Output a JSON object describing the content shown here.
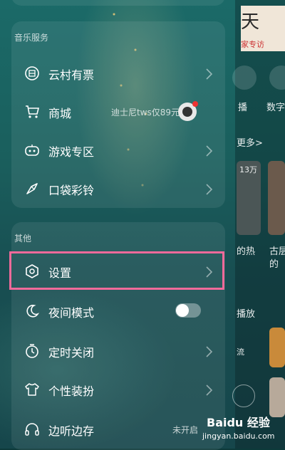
{
  "drawer": {
    "section_music": {
      "title": "音乐服务",
      "items": [
        {
          "label": "云村有票",
          "icon": "ticket-icon"
        },
        {
          "label": "商城",
          "icon": "cart-icon",
          "note": "迪士尼tws仅89元"
        },
        {
          "label": "游戏专区",
          "icon": "gamepad-icon"
        },
        {
          "label": "口袋彩铃",
          "icon": "ringtone-icon"
        }
      ]
    },
    "section_other": {
      "title": "其他",
      "items": [
        {
          "label": "设置",
          "icon": "settings-icon"
        },
        {
          "label": "夜间模式",
          "icon": "moon-icon",
          "toggle": false
        },
        {
          "label": "定时关闭",
          "icon": "timer-icon"
        },
        {
          "label": "个性装扮",
          "icon": "shirt-icon"
        },
        {
          "label": "边听边存",
          "icon": "headphones-icon",
          "note": "未开启"
        }
      ]
    }
  },
  "background": {
    "banner_big": "天",
    "banner_small": "家专访",
    "icon_label_1": "播",
    "icon_label_2": "数字",
    "more": "更多>",
    "thumb_badge": "13万",
    "text_1": "的热",
    "text_2": "古层",
    "text_3": "的",
    "play": "播放",
    "text_4": "流"
  },
  "watermark": {
    "main": "Baidu 经验",
    "sub": "jingyan.baidu.com"
  },
  "colors": {
    "highlight": "#f06a9a",
    "badge_red": "#e33333"
  }
}
